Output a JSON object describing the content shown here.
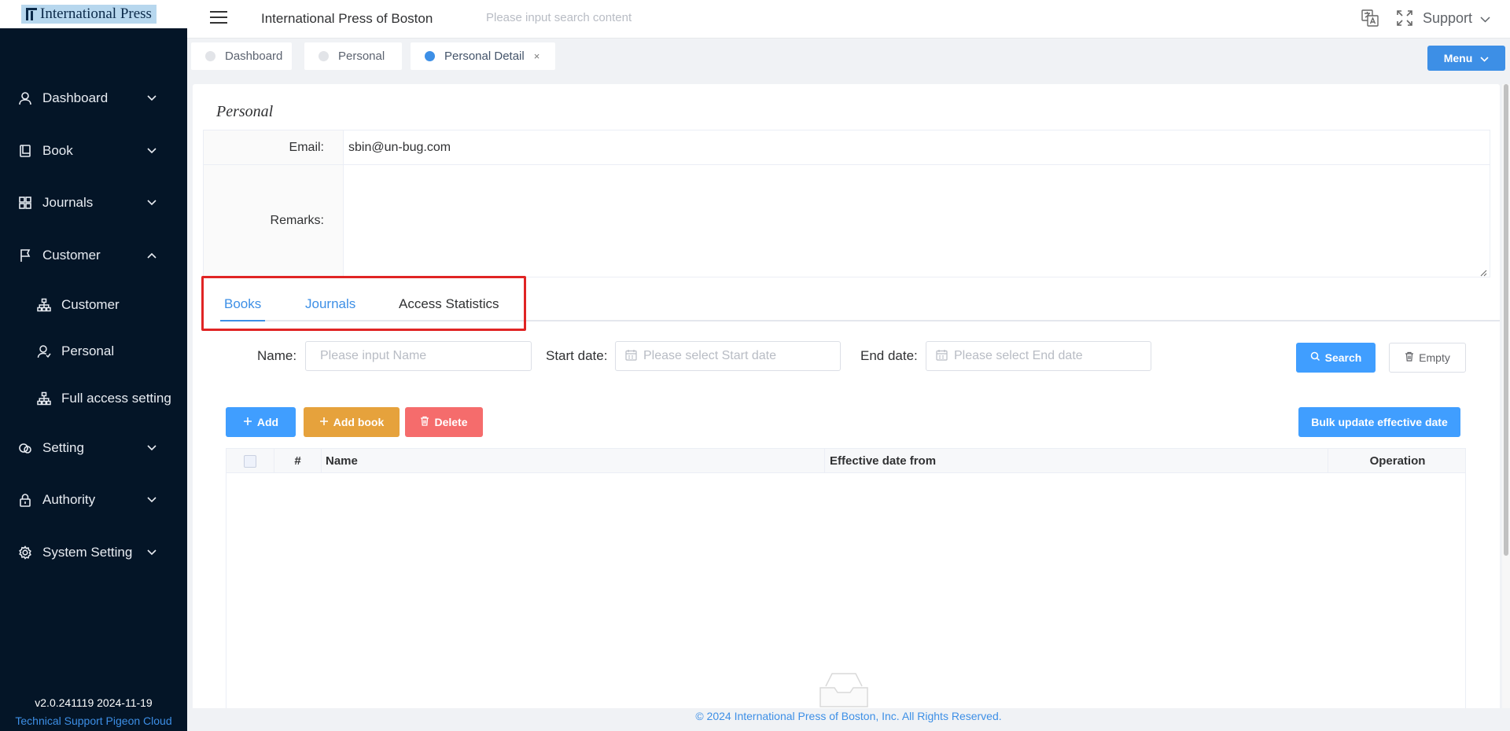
{
  "logo": {
    "text": "International Press"
  },
  "header": {
    "app_title": "International Press of Boston",
    "search_placeholder": "Please input search content",
    "support_label": "Support"
  },
  "sidebar": {
    "items": [
      {
        "label": "Dashboard",
        "icon": "user-icon"
      },
      {
        "label": "Book",
        "icon": "book-icon"
      },
      {
        "label": "Journals",
        "icon": "grid-icon"
      },
      {
        "label": "Customer",
        "icon": "flag-icon",
        "expanded": true
      },
      {
        "label": "Setting",
        "icon": "setting-icon"
      },
      {
        "label": "Authority",
        "icon": "lock-icon"
      },
      {
        "label": "System Setting",
        "icon": "gear-icon"
      }
    ],
    "subitems": [
      {
        "label": "Customer",
        "icon": "org-chart-icon"
      },
      {
        "label": "Personal",
        "icon": "person-icon"
      },
      {
        "label": "Full access setting",
        "icon": "org-chart-icon"
      }
    ],
    "version": "v2.0.241119 2024-11-19",
    "support_text": "Technical Support Pigeon Cloud"
  },
  "tabs": [
    {
      "label": "Dashboard",
      "active": false
    },
    {
      "label": "Personal",
      "active": false
    },
    {
      "label": "Personal Detail",
      "active": true,
      "closable": true,
      "close_glyph": "×"
    }
  ],
  "menu_button": "Menu",
  "personal": {
    "title": "Personal",
    "email_label": "Email:",
    "email_value": "sbin@un-bug.com",
    "remarks_label": "Remarks:",
    "remarks_value": ""
  },
  "subtabs": {
    "books": "Books",
    "journals": "Journals",
    "access": "Access Statistics"
  },
  "filters": {
    "name_label": "Name:",
    "name_placeholder": "Please input Name",
    "start_label": "Start date:",
    "start_placeholder": "Please select Start date",
    "end_label": "End date:",
    "end_placeholder": "Please select End date",
    "search_button": "Search",
    "empty_button": "Empty"
  },
  "actions": {
    "add": "Add",
    "add_book": "Add book",
    "delete": "Delete",
    "bulk_update": "Bulk update effective date"
  },
  "table": {
    "columns": [
      "#",
      "Name",
      "Effective date from",
      "Operation"
    ],
    "rows": []
  },
  "footer": "© 2024 International Press of Boston, Inc. All Rights Reserved.",
  "colors": {
    "sidebar_bg": "#041527",
    "primary": "#409eff",
    "warning": "#e6a23c",
    "danger": "#f56c6c",
    "highlight": "#e02424"
  }
}
